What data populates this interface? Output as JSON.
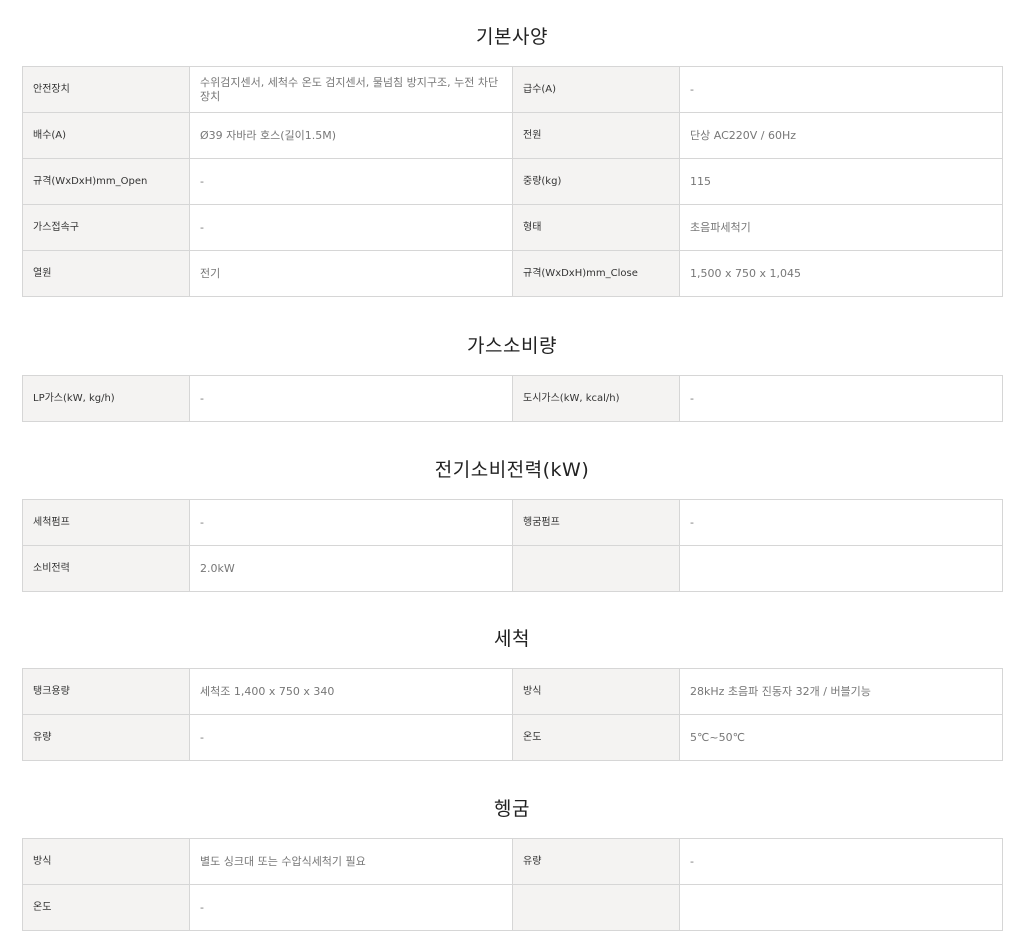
{
  "sections": [
    {
      "title": "기본사양",
      "rows": [
        [
          {
            "label": "안전장치",
            "value": "수위검지센서, 세척수 온도 검지센서, 물넘침 방지구조, 누전 차단장치"
          },
          {
            "label": "급수(A)",
            "value": "-"
          }
        ],
        [
          {
            "label": "배수(A)",
            "value": "Ø39 자바라 호스(길이1.5M)"
          },
          {
            "label": "전원",
            "value": "단상 AC220V / 60Hz"
          }
        ],
        [
          {
            "label": "규격(WxDxH)mm_Open",
            "value": "-"
          },
          {
            "label": "중량(kg)",
            "value": "115"
          }
        ],
        [
          {
            "label": "가스접속구",
            "value": "-"
          },
          {
            "label": "형태",
            "value": "초음파세척기"
          }
        ],
        [
          {
            "label": "열원",
            "value": "전기"
          },
          {
            "label": "규격(WxDxH)mm_Close",
            "value": "1,500 x 750 x 1,045"
          }
        ]
      ]
    },
    {
      "title": "가스소비량",
      "rows": [
        [
          {
            "label": "LP가스(kW, kg/h)",
            "value": "-"
          },
          {
            "label": "도시가스(kW, kcal/h)",
            "value": "-"
          }
        ]
      ]
    },
    {
      "title": "전기소비전력(kW)",
      "rows": [
        [
          {
            "label": "세척펌프",
            "value": "-"
          },
          {
            "label": "헹굼펌프",
            "value": "-"
          }
        ],
        [
          {
            "label": "소비전력",
            "value": "2.0kW"
          },
          {
            "label": "",
            "value": ""
          }
        ]
      ]
    },
    {
      "title": "세척",
      "rows": [
        [
          {
            "label": "탱크용량",
            "value": "세척조 1,400 x 750 x 340"
          },
          {
            "label": "방식",
            "value": "28kHz 초음파 진동자 32개 / 버블기능"
          }
        ],
        [
          {
            "label": "유량",
            "value": "-"
          },
          {
            "label": "온도",
            "value": "5℃~50℃"
          }
        ]
      ]
    },
    {
      "title": "헹굼",
      "rows": [
        [
          {
            "label": "방식",
            "value": "별도 싱크대 또는 수압식세척기 필요"
          },
          {
            "label": "유량",
            "value": "-"
          }
        ],
        [
          {
            "label": "온도",
            "value": "-"
          },
          {
            "label": "",
            "value": ""
          }
        ]
      ]
    }
  ]
}
